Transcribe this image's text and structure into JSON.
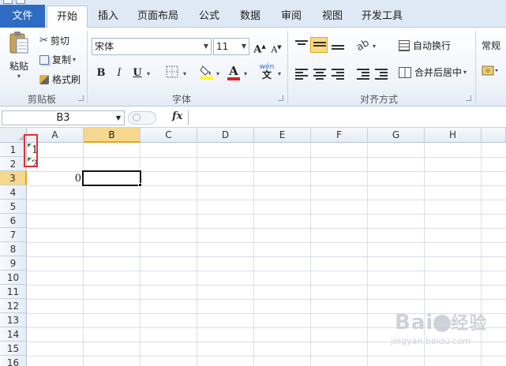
{
  "tabs": [
    {
      "label": "文件"
    },
    {
      "label": "开始"
    },
    {
      "label": "插入"
    },
    {
      "label": "页面布局"
    },
    {
      "label": "公式"
    },
    {
      "label": "数据"
    },
    {
      "label": "审阅"
    },
    {
      "label": "视图"
    },
    {
      "label": "开发工具"
    }
  ],
  "ribbon": {
    "clipboard": {
      "paste": "粘贴",
      "cut": "剪切",
      "copy": "复制",
      "format_painter": "格式刷",
      "group": "剪贴板"
    },
    "font": {
      "name": "宋体",
      "size": "11",
      "bold": "B",
      "italic": "I",
      "underline": "U",
      "group": "字体"
    },
    "alignment": {
      "wrap": "自动换行",
      "merge": "合并后居中",
      "group": "对齐方式"
    },
    "number": {
      "format": "常规"
    }
  },
  "formula_bar": {
    "name_box": "B3",
    "fx": "fx",
    "value": ""
  },
  "sheet": {
    "columns": [
      "A",
      "B",
      "C",
      "D",
      "E",
      "F",
      "G",
      "H"
    ],
    "rows": [
      "1",
      "2",
      "3",
      "4",
      "5",
      "6",
      "7",
      "8",
      "9",
      "10",
      "11",
      "12",
      "13",
      "14",
      "15",
      "16"
    ],
    "cells": {
      "A1": "1",
      "A2": "2",
      "A3": "0"
    },
    "selected_column": "B",
    "selected_row": "3"
  },
  "colors": {
    "file_tab": "#2e6cc4",
    "selection_header": "#f5d88d",
    "highlight_box": "#e03030",
    "error_marker": "#2e8b3c"
  }
}
